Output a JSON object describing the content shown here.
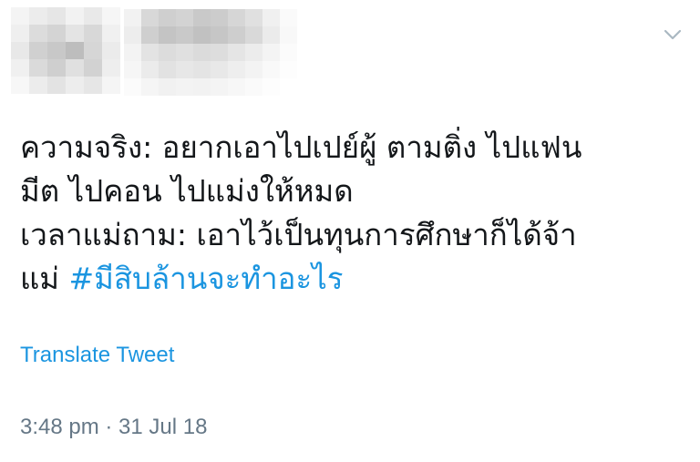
{
  "tweet": {
    "lines": [
      "ความจริง: อยากเอาไปเปย์ผู้ ตามติ่ง ไปแฟน",
      "มีต ไปคอน ไปแม่งให้หมด",
      "เวลาแม่ถาม: เอาไว้เป็นทุนการศึกษาก็ได้จ้า"
    ],
    "last_line_prefix": "แม่ ",
    "hashtag": "#มีสิบล้านจะทำอะไร"
  },
  "translate_label": "Translate Tweet",
  "timestamp": {
    "time": "3:48 pm",
    "separator": " · ",
    "date": "31 Jul 18"
  },
  "colors": {
    "link": "#1b95e0",
    "text": "#14171a",
    "meta": "#657786"
  },
  "icons": {
    "caret": "chevron-down-icon"
  }
}
